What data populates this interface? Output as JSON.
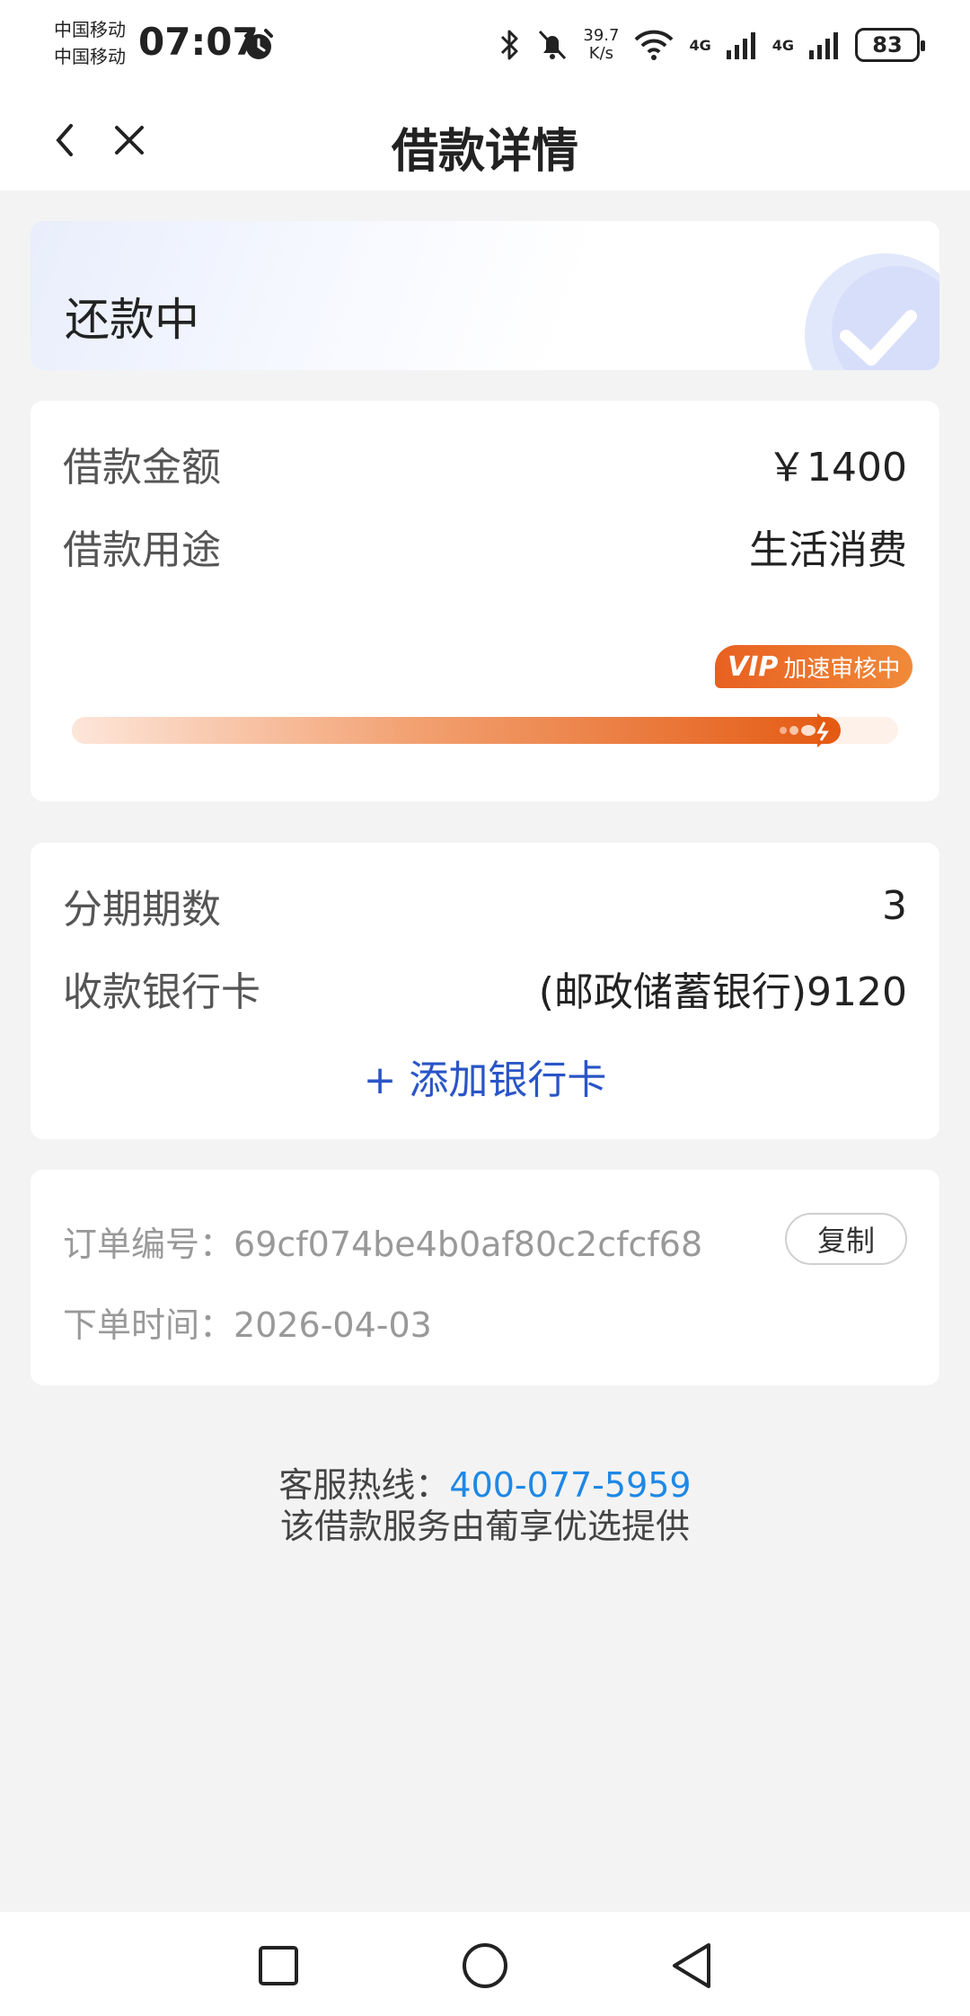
{
  "status_bar": {
    "carrier1": "中国移动",
    "carrier2": "中国移动",
    "time": "07:07",
    "speed_value": "39.7",
    "speed_unit": "K/s",
    "net1": "4G",
    "net2": "4G",
    "battery": "83"
  },
  "nav": {
    "title": "借款详情"
  },
  "status_card": {
    "status": "还款中"
  },
  "loan": {
    "amount_label": "借款金额",
    "amount_value": "￥1400",
    "purpose_label": "借款用途",
    "purpose_value": "生活消费",
    "badge_vip": "VIP",
    "badge_text": "加速审核中",
    "progress_fraction": 0.93
  },
  "bank": {
    "installments_label": "分期期数",
    "installments_value": "3",
    "card_label": "收款银行卡",
    "card_value": "(邮政储蓄银行)9120",
    "add_card_label": "+ 添加银行卡"
  },
  "order": {
    "order_no_label": "订单编号：",
    "order_no_value": "69cf074be4b0af80c2cfcf68",
    "copy_label": "复制",
    "time_label": "下单时间：",
    "time_value": "2026-04-03"
  },
  "footer": {
    "hotline_label": "客服热线：",
    "hotline_value": "400-077-5959",
    "provider": "该借款服务由葡享优选提供"
  },
  "colors": {
    "accent_blue": "#2a55c7",
    "link_blue": "#1e88e5",
    "progress_orange": "#e45a12"
  }
}
